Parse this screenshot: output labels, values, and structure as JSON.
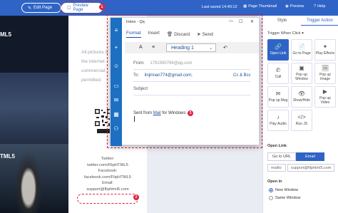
{
  "topbar": {
    "edit_page": "Edit Page",
    "preview_page": "Preview Page",
    "badge1": "1",
    "saved": "Last saved 14:40:12",
    "page_thumbnail": "Page Thumbnail",
    "preview": "Preview",
    "help": "Help"
  },
  "book": {
    "left_title": "ML5",
    "left_title2": "TML5",
    "paragraph": [
      "All pictures o",
      "the internet",
      "commercial",
      "permitted."
    ],
    "twitter_label": "Twitter:",
    "twitter": "twitter.com/FlipHTML5",
    "facebook_label": "Facebook:",
    "facebook": "facebook.com/FlipHTML5",
    "email_label": "Email:",
    "email": "support@fliphtml5.com",
    "badge2": "2"
  },
  "mail": {
    "title": "Inbox - Qq",
    "tabs": {
      "format": "Format",
      "insert": "Insert",
      "discard": "Discard",
      "send": "Send"
    },
    "heading": "Heading 1",
    "from_label": "From:",
    "from_value": "1791590794@qq.com",
    "to_label": "To:",
    "to_value": "linjinnan774@gmail.com;",
    "cc_bcc": "Cc & Bcc",
    "subject_label": "Subject",
    "body_prefix": "Sent from ",
    "body_link": "Mail",
    "body_suffix": " for Windows",
    "badge3": "3"
  },
  "panel": {
    "tab_style": "Style",
    "tab_trigger": "Trigger Action",
    "trigger_when": "Trigger When Click",
    "actions": [
      {
        "label": "Open Link",
        "icon": "link-icon",
        "glyph": "🔗",
        "selected": true
      },
      {
        "label": "Go to Page",
        "icon": "page-icon",
        "glyph": "📄",
        "selected": false
      },
      {
        "label": "Play Effects",
        "icon": "star-icon",
        "glyph": "✦",
        "selected": false
      },
      {
        "label": "Call",
        "icon": "phone-icon",
        "glyph": "✆",
        "selected": false
      },
      {
        "label": "Pop up Window",
        "icon": "window-icon",
        "glyph": "▣",
        "selected": false
      },
      {
        "label": "Pop up Image",
        "icon": "image-icon",
        "glyph": "🖼",
        "selected": false
      },
      {
        "label": "Pop up Msg",
        "icon": "message-icon",
        "glyph": "✉",
        "selected": false
      },
      {
        "label": "Show/Hide",
        "icon": "eye-icon",
        "glyph": "👁",
        "selected": false
      },
      {
        "label": "Pop up Video",
        "icon": "video-icon",
        "glyph": "▶",
        "selected": false
      },
      {
        "label": "Play Audio",
        "icon": "audio-icon",
        "glyph": "♪",
        "selected": false
      },
      {
        "label": "Run JS",
        "icon": "code-icon",
        "glyph": "</>",
        "selected": false
      }
    ],
    "open_link": "Open Link",
    "go_to_url": "Go to URL",
    "email": "Email",
    "mailto": "mailto",
    "address": "support@fliphtml5.com",
    "open_in": "Open in",
    "new_window": "New Window",
    "same_window": "Same Window"
  }
}
